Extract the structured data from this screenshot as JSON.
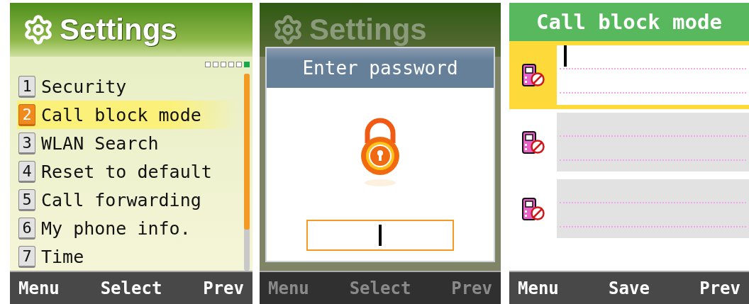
{
  "screens": [
    {
      "kind": "menu",
      "dimmed": false,
      "header": {
        "title": "Settings"
      },
      "pages": [
        {
          "selected": false
        },
        {
          "selected": false
        },
        {
          "selected": false
        },
        {
          "selected": false
        },
        {
          "selected": false
        },
        {
          "selected": true
        }
      ],
      "menu": [
        {
          "number": "1",
          "label": "Security",
          "selected": false
        },
        {
          "number": "2",
          "label": "Call block mode",
          "selected": true
        },
        {
          "number": "3",
          "label": "WLAN Search",
          "selected": false
        },
        {
          "number": "4",
          "label": "Reset to default",
          "selected": false
        },
        {
          "number": "5",
          "label": "Call forwarding",
          "selected": false
        },
        {
          "number": "6",
          "label": "My phone info.",
          "selected": false
        },
        {
          "number": "7",
          "label": "Time",
          "selected": false
        }
      ],
      "softkeys": {
        "left": "Menu",
        "center": "Select",
        "right": "Prev"
      }
    },
    {
      "kind": "password",
      "dimmed": true,
      "header": {
        "title": "Settings"
      },
      "dialog": {
        "title": "Enter password"
      },
      "softkeys": {
        "left": "Menu",
        "center": "Select",
        "right": "Prev"
      }
    },
    {
      "kind": "entry",
      "dimmed": false,
      "header": {
        "title": "Call block mode"
      },
      "entries": [
        {
          "selected": true
        },
        {
          "selected": false
        },
        {
          "selected": false
        }
      ],
      "softkeys": {
        "left": "Menu",
        "center": "Save",
        "right": "Prev"
      }
    }
  ]
}
